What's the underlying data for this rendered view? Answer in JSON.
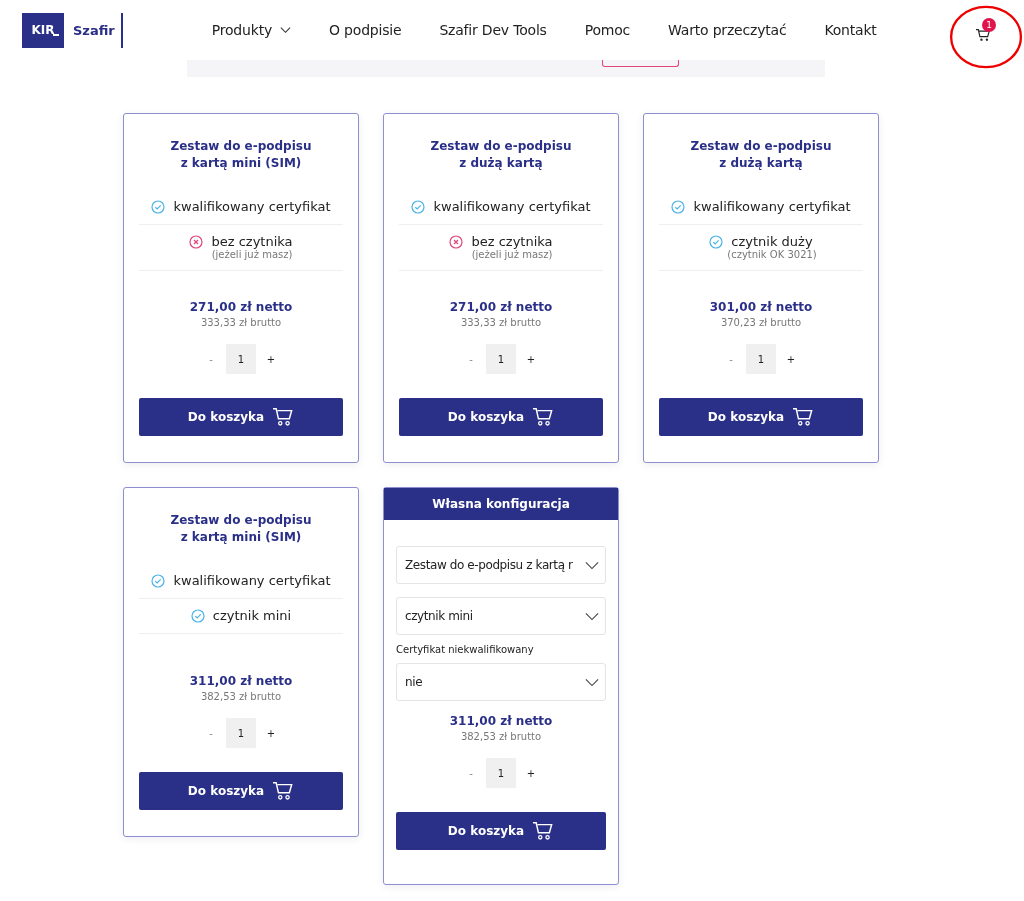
{
  "header": {
    "logo": {
      "mark": "KIR",
      "name": "Szafir"
    },
    "nav": [
      {
        "label": "Produkty",
        "dropdown": true
      },
      {
        "label": "O podpisie",
        "dropdown": false
      },
      {
        "label": "Szafir Dev Tools",
        "dropdown": false
      },
      {
        "label": "Pomoc",
        "dropdown": false
      },
      {
        "label": "Warto przeczytać",
        "dropdown": false
      },
      {
        "label": "Kontakt",
        "dropdown": false
      }
    ],
    "cart": {
      "count": "1",
      "highlighted": true
    }
  },
  "products": [
    {
      "kind": "preset",
      "title": [
        "Zestaw do e-podpisu",
        "z kartą mini (SIM)"
      ],
      "features": [
        {
          "included": true,
          "label": "kwalifikowany certyfikat"
        },
        {
          "included": false,
          "label": "bez czytnika",
          "note": "(jeżeli już masz)"
        }
      ],
      "net": "271,00 zł netto",
      "gross": "333,33 zł brutto",
      "qty": {
        "minus": "-",
        "value": "1",
        "plus": "+"
      },
      "button": "Do koszyka"
    },
    {
      "kind": "preset",
      "title": [
        "Zestaw do e-podpisu",
        "z dużą kartą"
      ],
      "features": [
        {
          "included": true,
          "label": "kwalifikowany certyfikat"
        },
        {
          "included": false,
          "label": "bez czytnika",
          "note": "(jeżeli już masz)"
        }
      ],
      "net": "271,00 zł netto",
      "gross": "333,33 zł brutto",
      "qty": {
        "minus": "-",
        "value": "1",
        "plus": "+"
      },
      "button": "Do koszyka"
    },
    {
      "kind": "preset",
      "title": [
        "Zestaw do e-podpisu",
        "z dużą kartą"
      ],
      "features": [
        {
          "included": true,
          "label": "kwalifikowany certyfikat"
        },
        {
          "included": true,
          "label": "czytnik duży",
          "note": "(czytnik OK 3021)"
        }
      ],
      "net": "301,00 zł netto",
      "gross": "370,23 zł brutto",
      "qty": {
        "minus": "-",
        "value": "1",
        "plus": "+"
      },
      "button": "Do koszyka"
    },
    {
      "kind": "preset",
      "title": [
        "Zestaw do e-podpisu",
        "z kartą mini (SIM)"
      ],
      "features": [
        {
          "included": true,
          "label": "kwalifikowany certyfikat"
        },
        {
          "included": true,
          "label": "czytnik mini"
        }
      ],
      "net": "311,00 zł netto",
      "gross": "382,53 zł brutto",
      "qty": {
        "minus": "-",
        "value": "1",
        "plus": "+"
      },
      "button": "Do koszyka"
    },
    {
      "kind": "custom",
      "header": "Własna konfiguracja",
      "selects": [
        {
          "value": "Zestaw do e-podpisu z kartą r"
        },
        {
          "value": "czytnik mini"
        },
        {
          "label": "Certyfikat niekwalifikowany",
          "value": "nie"
        }
      ],
      "net": "311,00 zł netto",
      "gross": "382,53 zł brutto",
      "qty": {
        "minus": "-",
        "value": "1",
        "plus": "+"
      },
      "button": "Do koszyka"
    }
  ]
}
